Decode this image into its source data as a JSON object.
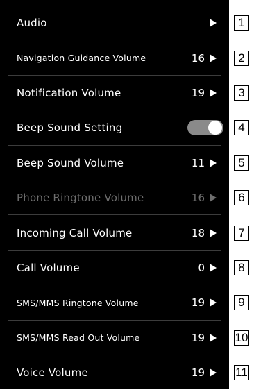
{
  "settings": {
    "items": [
      {
        "label": "Audio",
        "value": "",
        "control": "arrow",
        "small": false,
        "disabled": false
      },
      {
        "label": "Navigation Guidance Volume",
        "value": "16",
        "control": "arrow",
        "small": true,
        "disabled": false
      },
      {
        "label": "Notification Volume",
        "value": "19",
        "control": "arrow",
        "small": false,
        "disabled": false
      },
      {
        "label": "Beep Sound Setting",
        "value": "",
        "control": "toggle",
        "toggle_on": true,
        "small": false,
        "disabled": false
      },
      {
        "label": "Beep Sound Volume",
        "value": "11",
        "control": "arrow",
        "small": false,
        "disabled": false
      },
      {
        "label": "Phone Ringtone Volume",
        "value": "16",
        "control": "arrow",
        "small": false,
        "disabled": true
      },
      {
        "label": "Incoming Call Volume",
        "value": "18",
        "control": "arrow",
        "small": false,
        "disabled": false
      },
      {
        "label": "Call Volume",
        "value": "0",
        "control": "arrow",
        "small": false,
        "disabled": false
      },
      {
        "label": "SMS/MMS Ringtone Volume",
        "value": "19",
        "control": "arrow",
        "small": true,
        "disabled": false
      },
      {
        "label": "SMS/MMS Read Out Volume",
        "value": "19",
        "control": "arrow",
        "small": true,
        "disabled": false
      },
      {
        "label": "Voice Volume",
        "value": "19",
        "control": "arrow",
        "small": false,
        "disabled": false
      }
    ]
  },
  "callouts": [
    "1",
    "2",
    "3",
    "4",
    "5",
    "6",
    "7",
    "8",
    "9",
    "10",
    "11"
  ],
  "colors": {
    "background": "#000000",
    "text": "#ffffff",
    "disabled_text": "#6e6e6e",
    "divider": "#3c3c3c",
    "toggle_track": "#8a8a8a"
  },
  "icons": {
    "arrow": "right-triangle-icon",
    "toggle": "toggle-switch"
  }
}
